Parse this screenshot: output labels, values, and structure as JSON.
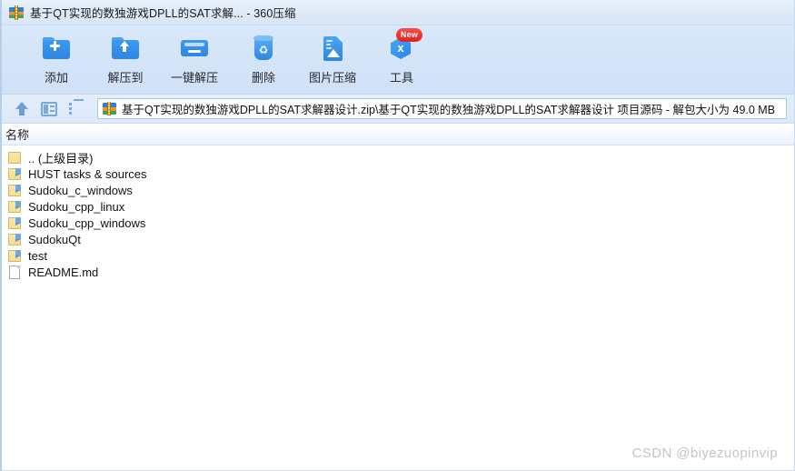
{
  "window": {
    "title": "基于QT实现的数独游戏DPLL的SAT求解... - 360压缩",
    "title_icon": "archive-zip-icon"
  },
  "toolbar": {
    "buttons": [
      {
        "label": "添加",
        "icon": "folder-add-icon",
        "badge": ""
      },
      {
        "label": "解压到",
        "icon": "folder-extract-icon",
        "badge": ""
      },
      {
        "label": "一键解压",
        "icon": "folder-onekey-extract-icon",
        "badge": ""
      },
      {
        "label": "删除",
        "icon": "trash-delete-icon",
        "badge": ""
      },
      {
        "label": "图片压缩",
        "icon": "image-compress-icon",
        "badge": ""
      },
      {
        "label": "工具",
        "icon": "tools-cube-icon",
        "badge": "New"
      }
    ]
  },
  "pathbar": {
    "nav_icons": [
      "up-arrow-icon",
      "preview-panel-icon",
      "list-view-icon"
    ],
    "path_icon": "archive-zip-icon",
    "path": "基于QT实现的数独游戏DPLL的SAT求解器设计.zip\\基于QT实现的数独游戏DPLL的SAT求解器设计 项目源码 - 解包大小为 49.0 MB"
  },
  "list": {
    "column_header": "名称",
    "rows": [
      {
        "name": ".. (上级目录)",
        "icon": "folder-plain-icon"
      },
      {
        "name": "HUST tasks &  sources",
        "icon": "folder-icon"
      },
      {
        "name": "Sudoku_c_windows",
        "icon": "folder-icon"
      },
      {
        "name": "Sudoku_cpp_linux",
        "icon": "folder-icon"
      },
      {
        "name": "Sudoku_cpp_windows",
        "icon": "folder-icon"
      },
      {
        "name": "SudokuQt",
        "icon": "folder-icon"
      },
      {
        "name": "test",
        "icon": "folder-icon"
      },
      {
        "name": "README.md",
        "icon": "document-icon"
      }
    ]
  },
  "watermark": {
    "text": "CSDN @biyezuopinvip"
  },
  "colors": {
    "titlebar": "#e0ebf8",
    "toolbar": "#d4e4f8",
    "accent_blue": "#2f86e3",
    "folder_yellow": "#f7dd92",
    "badge_red": "#e81f1f",
    "watermark_gray": "#c4c4c4"
  }
}
